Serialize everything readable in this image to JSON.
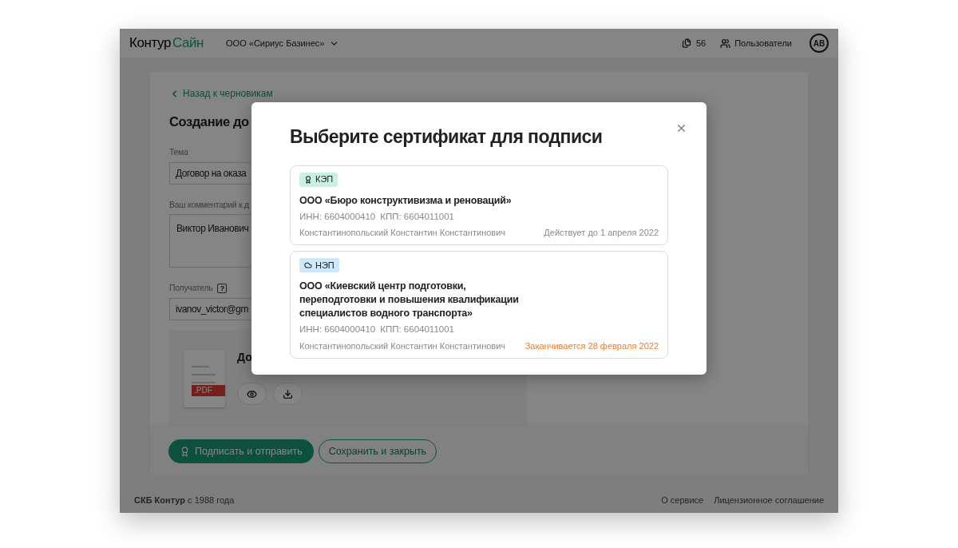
{
  "header": {
    "logo": {
      "word_1": "Контур",
      "word_2": "Сайн"
    },
    "org": "ООО «Сириус Базинес»",
    "docs_count": "56",
    "users_label": "Пользователи",
    "avatar": "AB"
  },
  "page": {
    "back_link": "Назад к черновикам",
    "title": "Создание до",
    "fields": [
      {
        "kind": "input",
        "label": "Тема",
        "value": "Договор на оказа"
      },
      {
        "kind": "textarea",
        "label": "Ваш комментарий к д",
        "value": "Виктор Иванович"
      },
      {
        "kind": "input",
        "label": "Получатель",
        "value": "ivanov_victor@gm",
        "help": "?"
      }
    ],
    "document": {
      "title_lines": [
        "До"
      ],
      "badge": ".PDF"
    },
    "actions": [
      {
        "kind": "primary",
        "label": "Подписать и отправить"
      },
      {
        "kind": "secondary",
        "label": "Сохранить и закрыть"
      }
    ]
  },
  "footer": {
    "brand": "**СКБ Контур** с 1988 года",
    "links": [
      "О сервисе",
      "Лицензионное соглашение"
    ]
  },
  "modal": {
    "title": "Выберите сертификат для подписи",
    "certificates": [
      {
        "kind": "qualified",
        "type_label": "КЭП",
        "org": "ООО «Бюро конструктивизма и реноваций»",
        "inn": "ИНН: 6604000410",
        "kpp": "КПП: 6604011001",
        "owner": "Константинопольский Константин Константинович",
        "validity": "Действует до 1 апреля 2022",
        "expiring": false
      },
      {
        "kind": "unqualified",
        "type_label": "НЭП",
        "org": "ООО «Киевский центр подготовки, переподготовки и повышения квалификации специалистов водного транспорта»",
        "inn": "ИНН: 6604000410",
        "kpp": "КПП: 6604011001",
        "owner": "Константинопольский Константин Константинович",
        "validity": "Заканчивается 28 февраля 2022",
        "expiring": true
      }
    ]
  }
}
